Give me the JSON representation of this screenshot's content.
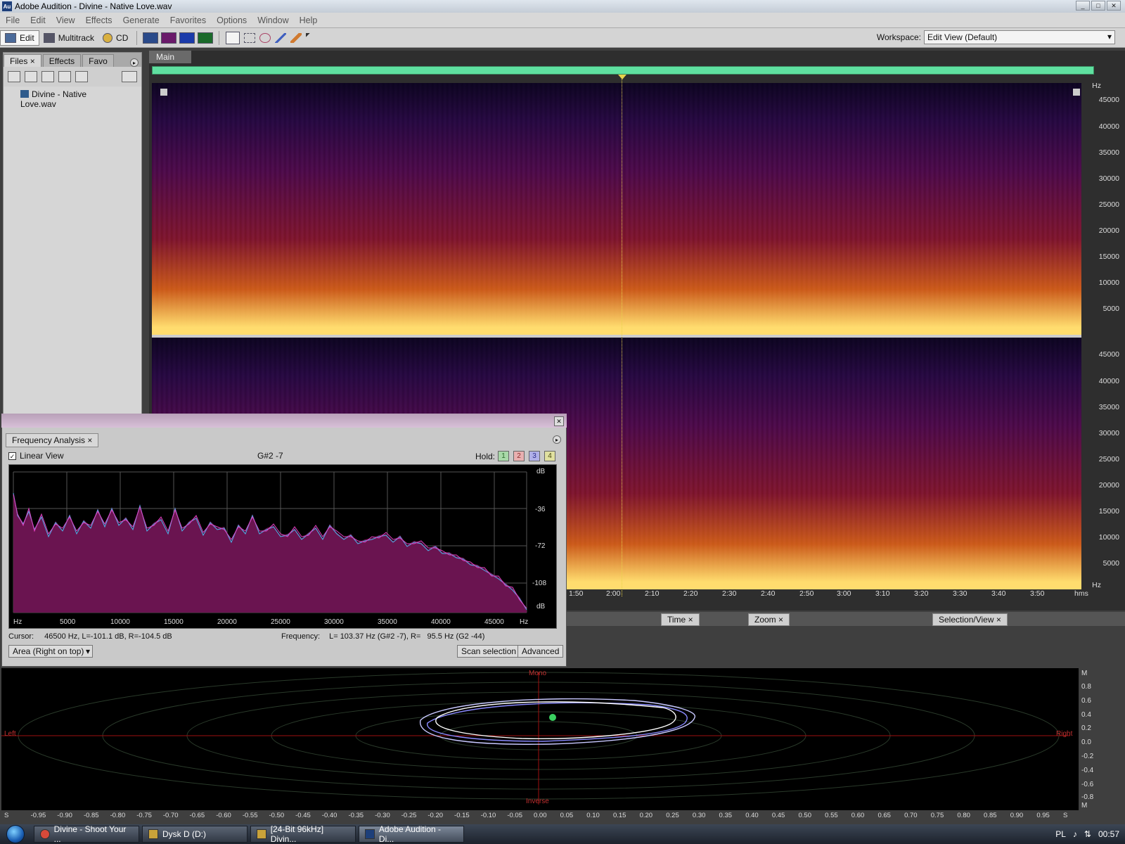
{
  "window": {
    "title": "Adobe Audition - Divine - Native Love.wav",
    "app_icon": "Au"
  },
  "menu": [
    "File",
    "Edit",
    "View",
    "Effects",
    "Generate",
    "Favorites",
    "Options",
    "Window",
    "Help"
  ],
  "toolbar": {
    "edit": "Edit",
    "multitrack": "Multitrack",
    "cd": "CD",
    "workspace_label": "Workspace:",
    "workspace_value": "Edit View (Default)"
  },
  "files_panel": {
    "tabs": [
      "Files",
      "Effects",
      "Favo"
    ],
    "files": [
      "Divine - Native Love.wav"
    ]
  },
  "main": {
    "tab": "Main"
  },
  "hz_scale": {
    "unit_top": "Hz",
    "labels": [
      "45000",
      "40000",
      "35000",
      "30000",
      "25000",
      "20000",
      "15000",
      "10000",
      "5000"
    ],
    "unit_bottom": "Hz"
  },
  "timeline": {
    "ticks": [
      "1:50",
      "2:00",
      "2:10",
      "2:20",
      "2:30",
      "2:40",
      "2:50",
      "3:00",
      "3:10",
      "3:20",
      "3:30",
      "3:40",
      "3:50"
    ],
    "unit": "hms"
  },
  "mid_tabs": {
    "time": "Time",
    "zoom": "Zoom",
    "selection": "Selection/View"
  },
  "freq_analysis": {
    "tab": "Frequency Analysis",
    "linear_view": "Linear View",
    "note": "G#2 -7",
    "hold_label": "Hold:",
    "hold": [
      "1",
      "2",
      "3",
      "4"
    ],
    "db_labels": [
      "dB",
      "-36",
      "-72",
      "-108",
      "dB"
    ],
    "x_labels": [
      "Hz",
      "5000",
      "10000",
      "15000",
      "20000",
      "25000",
      "30000",
      "35000",
      "40000",
      "45000",
      "Hz"
    ],
    "cursor_label": "Cursor:",
    "cursor_value": "46500 Hz, L=-101.1 dB, R=-104.5 dB",
    "frequency_label": "Frequency:",
    "frequency_value": "L= 103.37 Hz (G#2 -7), R=   95.5 Hz (G2 -44)",
    "display_mode": "Area (Right on top)",
    "scan_selection": "Scan selection",
    "advanced": "Advanced"
  },
  "phase": {
    "mono": "Mono",
    "inverse": "Inverse",
    "left": "Left",
    "right": "Right",
    "y_labels": [
      "M",
      "0.8",
      "0.6",
      "0.4",
      "0.2",
      "0.0",
      "-0.2",
      "-0.4",
      "-0.6",
      "-0.8",
      "M"
    ],
    "x_labels": [
      "S",
      "-0.95",
      "-0.90",
      "-0.85",
      "-0.80",
      "-0.75",
      "-0.70",
      "-0.65",
      "-0.60",
      "-0.55",
      "-0.50",
      "-0.45",
      "-0.40",
      "-0.35",
      "-0.30",
      "-0.25",
      "-0.20",
      "-0.15",
      "-0.10",
      "-0.05",
      "0.00",
      "0.05",
      "0.10",
      "0.15",
      "0.20",
      "0.25",
      "0.30",
      "0.35",
      "0.40",
      "0.45",
      "0.50",
      "0.55",
      "0.60",
      "0.65",
      "0.70",
      "0.75",
      "0.80",
      "0.85",
      "0.90",
      "0.95",
      "S"
    ]
  },
  "taskbar": {
    "tasks": [
      "Divine - Shoot Your ...",
      "Dysk D (D:)",
      "[24-Bit 96kHz] Divin...",
      "Adobe Audition - Di..."
    ],
    "lang": "PL",
    "clock": "00:57"
  },
  "colors": {
    "accent_green": "#5fe0a0",
    "spectrum_fill": "#6a1450",
    "spectrum_left": "#4fb0e8",
    "spectrum_right": "#e040c0",
    "playhead": "#e6d24a"
  }
}
